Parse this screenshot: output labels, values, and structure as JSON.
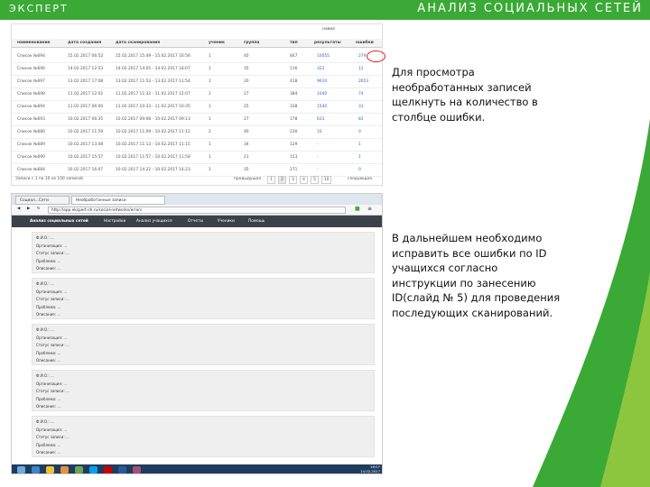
{
  "header": {
    "brand": "ЭКСПЕРТ",
    "title": "АНАЛИЗ СОЦИАЛЬНЫХ СЕТЕЙ"
  },
  "colors": {
    "brand_green": "#3aa935",
    "link_blue": "#3366cc",
    "highlight_red": "#d9262a"
  },
  "table": {
    "new_label": "новое",
    "columns": [
      "наименование",
      "дата создания",
      "дата сканирования",
      "ученик",
      "группа",
      "тип",
      "результаты",
      "ошибки"
    ],
    "rows": [
      [
        "Список №694",
        "15.02.2017 06:52",
        "15.02.2017 15:49 - 15.02.2017 16:56",
        "1",
        "40",
        "847",
        "10055",
        "279"
      ],
      [
        "Список №696",
        "14.02.2017 12:53",
        "14.02.2017 14:05 - 14.02.2017 18:07",
        "1",
        "35",
        "116",
        "322",
        "12"
      ],
      [
        "Список №697",
        "13.02.2017 17:08",
        "13.02.2017 11:53 - 13.02.2017 11:54",
        "1",
        "20",
        "418",
        "9610",
        "2653"
      ],
      [
        "Список №698",
        "11.02.2017 12:02",
        "11.02.2017 11:32 - 11.02.2017 12:07",
        "1",
        "27",
        "384",
        "1040",
        "74"
      ],
      [
        "Список №694",
        "11.02.2017 06:00",
        "11.02.2017 10:33 - 11.02.2017 10:35",
        "1",
        "25",
        "338",
        "1540",
        "33"
      ],
      [
        "Список №693",
        "10.02.2017 06:35",
        "10.02.2017 09:08 - 10.02.2017 09:13",
        "1",
        "27",
        "178",
        "633",
        "83"
      ],
      [
        "Список №680",
        "10.02.2017 11:59",
        "10.02.2017 11:09 - 10.02.2017 11:12",
        "2",
        "40",
        "230",
        "33",
        "0"
      ],
      [
        "Список №689",
        "10.02.2017 13:08",
        "10.02.2017 11:13 - 10.02.2017 11:15",
        "1",
        "34",
        "129",
        "-",
        "1"
      ],
      [
        "Список №690",
        "10.02.2017 15:57",
        "10.02.2017 11:57 - 10.02.2017 11:58",
        "1",
        "21",
        "153",
        "-",
        "1"
      ],
      [
        "Список №684",
        "10.02.2017 16:07",
        "10.02.2017 14:22 - 10.02.2017 14:23",
        "1",
        "35",
        "271",
        "-",
        "0"
      ]
    ],
    "footer_info": "Записи с 1 по 10 из 100 записей",
    "pager_prev": "предыдущая",
    "pager_next": "следующая",
    "pages": [
      "1",
      "2",
      "3",
      "4",
      "5",
      "10"
    ]
  },
  "browser": {
    "tabs": [
      "Социал...Сети",
      "Необработанные записи"
    ],
    "url": "http://app.ekspert-sh.ru/social-networks/errors",
    "nav": [
      "Анализ социальных сетей",
      "Настройки",
      "Анализ учащихся",
      "Отчеты",
      "Ученики",
      "Помощь"
    ],
    "records": [
      {
        "name": "Ф.И.О.: ...",
        "org": "Организация: ...",
        "status": "Статус записи: ...",
        "problem": "Проблема: ...",
        "desc": "Описание: ..."
      },
      {
        "name": "Ф.И.О.: ...",
        "org": "Организация: ...",
        "status": "Статус записи: ...",
        "problem": "Проблема: ...",
        "desc": "Описание: ..."
      },
      {
        "name": "Ф.И.О.: ...",
        "org": "Организация: ...",
        "status": "Статус записи: ...",
        "problem": "Проблема: ...",
        "desc": "Описание: ..."
      },
      {
        "name": "Ф.И.О.: ...",
        "org": "Организация: ...",
        "status": "Статус записи: ...",
        "problem": "Проблема: ...",
        "desc": "Описание: ..."
      },
      {
        "name": "Ф.И.О.: ...",
        "org": "Организация: ...",
        "status": "Статус записи: ...",
        "problem": "Проблема: ...",
        "desc": "Описание: ..."
      }
    ],
    "taskbar_icons": [
      "start-icon",
      "ie-icon",
      "folder-icon",
      "media-icon",
      "chrome-icon",
      "skype-icon",
      "yandex-icon",
      "word-icon",
      "paint-icon"
    ],
    "clock": {
      "time": "16:07",
      "date": "14.02.2017"
    }
  },
  "notes": {
    "first": "Для просмотра необработанных записей щелкнуть на количество в столбце ошибки.",
    "second": "В дальнейшем необходимо исправить все ошибки по ID учащихся согласно инструкции по занесению ID(слайд № 5) для проведения последующих сканирований."
  }
}
